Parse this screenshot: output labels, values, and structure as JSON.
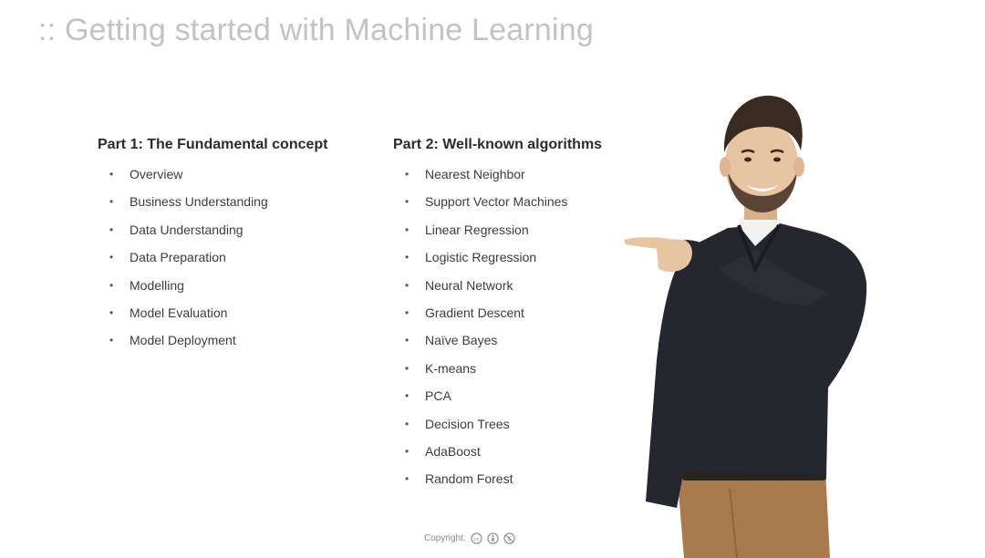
{
  "slide": {
    "title": ":: Getting started with Machine Learning"
  },
  "part1": {
    "heading": "Part 1:  The Fundamental concept",
    "items": [
      "Overview",
      "Business Understanding",
      "Data Understanding",
      "Data Preparation",
      "Modelling",
      "Model Evaluation",
      "Model Deployment"
    ]
  },
  "part2": {
    "heading": "Part 2:  Well-known algorithms",
    "items": [
      "Nearest Neighbor",
      "Support Vector Machines",
      "Linear Regression",
      "Logistic Regression",
      "Neural Network",
      "Gradient Descent",
      "Naïve Bayes",
      "K-means",
      "PCA",
      "Decision Trees",
      "AdaBoost",
      "Random Forest"
    ]
  },
  "footer": {
    "copyright_label": "Copyright:",
    "icons": [
      "cc-icon",
      "by-icon",
      "nc-icon"
    ]
  },
  "colors": {
    "title": "#c3c3c3",
    "heading": "#2b2b2b",
    "body_text": "#3d3d3d",
    "sweater": "#26262e",
    "pants": "#a87a4e",
    "skin": "#e7c4a2",
    "hair": "#3a2b22"
  }
}
